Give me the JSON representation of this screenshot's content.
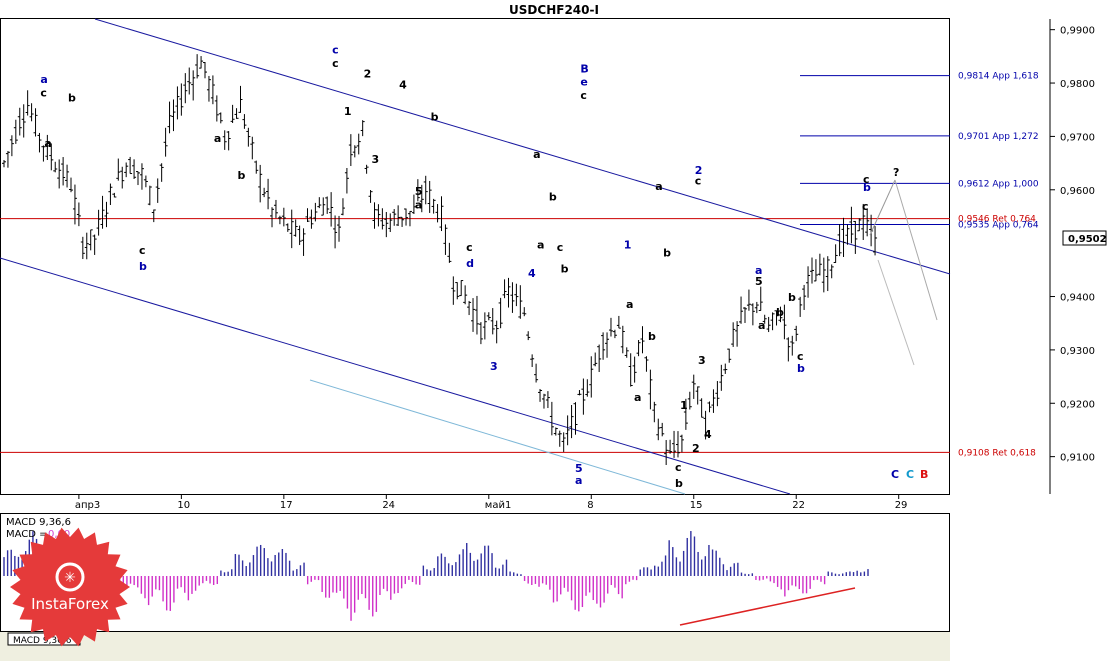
{
  "window": {
    "title": "USDCHF240-I"
  },
  "chart_data": {
    "type": "candlestick",
    "symbol": "USDCHF",
    "timeframe": "H4",
    "price_axis": {
      "ylim": [
        0.903,
        0.992
      ],
      "ticks": [
        "0,9900",
        "0,9800",
        "0,9700",
        "0,9600",
        "0,9400",
        "0,9300",
        "0,9200",
        "0,9100"
      ],
      "tick_values": [
        0.99,
        0.98,
        0.97,
        0.96,
        0.94,
        0.93,
        0.92,
        0.91
      ],
      "current_price_label": "0,9502",
      "current_price": 0.9502
    },
    "time_axis": {
      "labels": [
        "апр3",
        "10",
        "17",
        "24",
        "май1",
        "8",
        "15",
        "22",
        "29"
      ],
      "bar_index": [
        19,
        45,
        71,
        97,
        123,
        149,
        175,
        201,
        227
      ],
      "total_bars": 240
    },
    "levels": [
      {
        "label": "0,9814 App 1,618",
        "value": 0.9814,
        "color": "#0000aa"
      },
      {
        "label": "0,9701 App 1,272",
        "value": 0.9701,
        "color": "#0000aa"
      },
      {
        "label": "0,9612 App 1,000",
        "value": 0.9612,
        "color": "#0000aa"
      },
      {
        "label": "0,9546 Ret 0,764",
        "value": 0.9546,
        "color": "#cc0000"
      },
      {
        "label": "0,9535 App 0,764",
        "value": 0.9535,
        "color": "#0000aa"
      },
      {
        "label": "0,9108 Ret 0,618",
        "value": 0.9108,
        "color": "#cc0000"
      }
    ],
    "price_path": [
      [
        0,
        0.965
      ],
      [
        4,
        0.973
      ],
      [
        6,
        0.976
      ],
      [
        9,
        0.97
      ],
      [
        12,
        0.966
      ],
      [
        17,
        0.961
      ],
      [
        20,
        0.95
      ],
      [
        23,
        0.951
      ],
      [
        27,
        0.959
      ],
      [
        31,
        0.965
      ],
      [
        35,
        0.963
      ],
      [
        38,
        0.957
      ],
      [
        42,
        0.972
      ],
      [
        46,
        0.979
      ],
      [
        50,
        0.984
      ],
      [
        53,
        0.978
      ],
      [
        56,
        0.97
      ],
      [
        60,
        0.976
      ],
      [
        64,
        0.964
      ],
      [
        68,
        0.956
      ],
      [
        72,
        0.953
      ],
      [
        75,
        0.951
      ],
      [
        78,
        0.955
      ],
      [
        82,
        0.958
      ],
      [
        85,
        0.952
      ],
      [
        88,
        0.968
      ],
      [
        91,
        0.971
      ],
      [
        94,
        0.955
      ],
      [
        97,
        0.954
      ],
      [
        100,
        0.955
      ],
      [
        104,
        0.956
      ],
      [
        107,
        0.96
      ],
      [
        111,
        0.955
      ],
      [
        114,
        0.943
      ],
      [
        118,
        0.939
      ],
      [
        121,
        0.934
      ],
      [
        125,
        0.935
      ],
      [
        128,
        0.941
      ],
      [
        132,
        0.937
      ],
      [
        135,
        0.926
      ],
      [
        139,
        0.917
      ],
      [
        142,
        0.912
      ],
      [
        145,
        0.918
      ],
      [
        149,
        0.925
      ],
      [
        152,
        0.932
      ],
      [
        156,
        0.935
      ],
      [
        159,
        0.925
      ],
      [
        162,
        0.932
      ],
      [
        165,
        0.918
      ],
      [
        169,
        0.91
      ],
      [
        172,
        0.913
      ],
      [
        175,
        0.924
      ],
      [
        178,
        0.916
      ],
      [
        182,
        0.925
      ],
      [
        185,
        0.932
      ],
      [
        188,
        0.937
      ],
      [
        191,
        0.939
      ],
      [
        194,
        0.934
      ],
      [
        197,
        0.937
      ],
      [
        200,
        0.93
      ],
      [
        203,
        0.942
      ],
      [
        206,
        0.944
      ],
      [
        209,
        0.945
      ],
      [
        212,
        0.95
      ],
      [
        215,
        0.952
      ],
      [
        218,
        0.954
      ],
      [
        221,
        0.95
      ]
    ],
    "wave_labels": [
      {
        "text": "a",
        "bar": 10,
        "price": 0.98,
        "color": "#0000aa"
      },
      {
        "text": "c",
        "bar": 10,
        "price": 0.9775,
        "color": "#000000"
      },
      {
        "text": "b",
        "bar": 17,
        "price": 0.9765,
        "color": "#000000"
      },
      {
        "text": "a",
        "bar": 11,
        "price": 0.968,
        "color": "#000000"
      },
      {
        "text": "c",
        "bar": 35,
        "price": 0.948,
        "color": "#000000"
      },
      {
        "text": "b",
        "bar": 35,
        "price": 0.945,
        "color": "#0000aa"
      },
      {
        "text": "b",
        "bar": 60,
        "price": 0.962,
        "color": "#000000"
      },
      {
        "text": "a",
        "bar": 54,
        "price": 0.969,
        "color": "#000000"
      },
      {
        "text": "c",
        "bar": 84,
        "price": 0.9855,
        "color": "#0000aa"
      },
      {
        "text": "c",
        "bar": 84,
        "price": 0.983,
        "color": "#000000"
      },
      {
        "text": "2",
        "bar": 92,
        "price": 0.981,
        "color": "#000000"
      },
      {
        "text": "1",
        "bar": 87,
        "price": 0.974,
        "color": "#000000"
      },
      {
        "text": "4",
        "bar": 101,
        "price": 0.979,
        "color": "#000000"
      },
      {
        "text": "3",
        "bar": 94,
        "price": 0.965,
        "color": "#000000"
      },
      {
        "text": "b",
        "bar": 109,
        "price": 0.973,
        "color": "#000000"
      },
      {
        "text": "5",
        "bar": 105,
        "price": 0.959,
        "color": "#000000"
      },
      {
        "text": "a",
        "bar": 105,
        "price": 0.9565,
        "color": "#000000"
      },
      {
        "text": "c",
        "bar": 118,
        "price": 0.9485,
        "color": "#000000"
      },
      {
        "text": "d",
        "bar": 118,
        "price": 0.9455,
        "color": "#0000aa"
      },
      {
        "text": "a",
        "bar": 135,
        "price": 0.966,
        "color": "#000000"
      },
      {
        "text": "b",
        "bar": 139,
        "price": 0.958,
        "color": "#000000"
      },
      {
        "text": "a",
        "bar": 136,
        "price": 0.949,
        "color": "#000000"
      },
      {
        "text": "c",
        "bar": 141,
        "price": 0.9485,
        "color": "#000000"
      },
      {
        "text": "b",
        "bar": 142,
        "price": 0.9445,
        "color": "#000000"
      },
      {
        "text": "B",
        "bar": 147,
        "price": 0.982,
        "color": "#0000aa"
      },
      {
        "text": "e",
        "bar": 147,
        "price": 0.9795,
        "color": "#0000aa"
      },
      {
        "text": "c",
        "bar": 147,
        "price": 0.977,
        "color": "#000000"
      },
      {
        "text": "1",
        "bar": 158,
        "price": 0.949,
        "color": "#0000aa"
      },
      {
        "text": "a",
        "bar": 166,
        "price": 0.96,
        "color": "#000000"
      },
      {
        "text": "2",
        "bar": 176,
        "price": 0.963,
        "color": "#0000aa"
      },
      {
        "text": "c",
        "bar": 176,
        "price": 0.961,
        "color": "#000000"
      },
      {
        "text": "b",
        "bar": 168,
        "price": 0.9475,
        "color": "#000000"
      },
      {
        "text": "4",
        "bar": 216,
        "price": 0.943,
        "color": "#0000aa"
      },
      {
        "text": "3",
        "bar": 200,
        "price": 0.9265,
        "color": "#0000aa"
      },
      {
        "text": "5",
        "bar": 234,
        "price": 0.9065,
        "color": "#0000aa"
      },
      {
        "text": "a",
        "bar": 234,
        "price": 0.904,
        "color": "#0000aa"
      }
    ],
    "macd": {
      "label": "MACD 9,36,6",
      "label_value": "MACD =",
      "value": "0,00",
      "tab_label": "MACD 9,36,6",
      "histogram": [
        0.6,
        0.9,
        1.0,
        0.8,
        0.5,
        0.3,
        0.1,
        -0.1,
        -0.3,
        -0.5,
        -0.7,
        -0.8,
        -0.6,
        -0.4,
        -0.2,
        0.2,
        0.5,
        0.7,
        0.8,
        0.6,
        0.3,
        -0.2,
        -0.5,
        -0.8,
        -1.0,
        -0.9,
        -0.7,
        -0.4,
        -0.2,
        0.3,
        0.5,
        0.6,
        0.8,
        0.7,
        0.4,
        0.1,
        -0.2,
        -0.4,
        -0.6,
        -0.8,
        -0.9,
        -0.7,
        -0.5,
        -0.2,
        0.2,
        0.5,
        0.8,
        1.0,
        0.9,
        0.6,
        0.3,
        0.1,
        -0.1,
        -0.3,
        -0.5,
        -0.4,
        -0.2,
        0.1,
        0.1,
        0.2
      ]
    }
  },
  "watermark": {
    "brand_text": "InstaForex"
  },
  "corner_labels": {
    "c1": "C",
    "c2": "C",
    "c3": "B",
    "q": "?"
  },
  "extra_labels": {
    "p1": "c",
    "p2": "b",
    "p3": "c",
    "p4": "b",
    "p5": "5",
    "p6": "a",
    "p7": "a",
    "p8": "b",
    "p9": "a",
    "p10": "b",
    "p11": "c",
    "p12": "b",
    "p13": "1",
    "p14": "2",
    "p15": "3",
    "p16": "4",
    "p17": "b",
    "p18": "c",
    "p19": "a",
    "p20": "c",
    "p21": "b"
  }
}
